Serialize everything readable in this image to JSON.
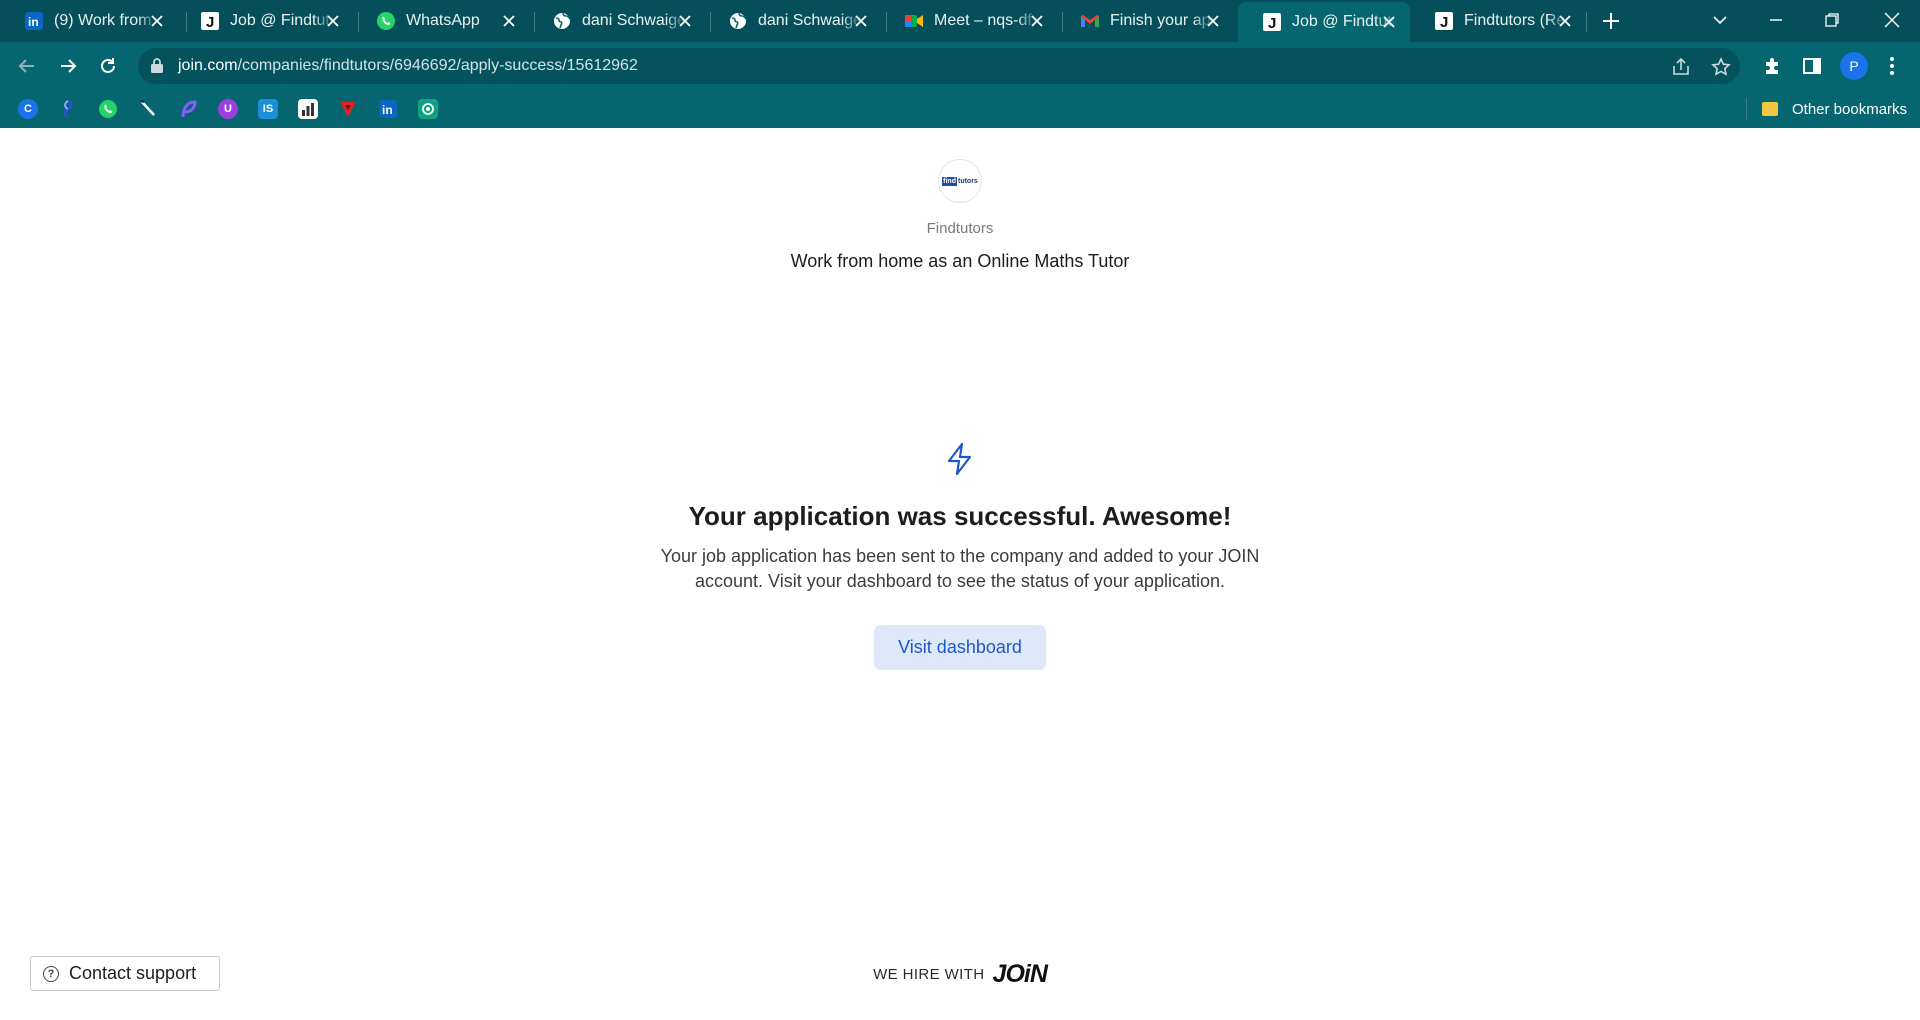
{
  "browser": {
    "tabs": [
      {
        "title": "(9) Work from",
        "icon": "linkedin-icon",
        "active": false
      },
      {
        "title": "Job @ Findtutors",
        "icon": "join-icon",
        "active": false
      },
      {
        "title": "WhatsApp",
        "icon": "whatsapp-icon",
        "active": false
      },
      {
        "title": "dani Schwaiger",
        "icon": "globe-icon",
        "active": false
      },
      {
        "title": "dani Schwaiger",
        "icon": "globe-icon",
        "active": false
      },
      {
        "title": "Meet – nqs-dfx",
        "icon": "google-meet-icon",
        "active": false
      },
      {
        "title": "Finish your application",
        "icon": "gmail-icon",
        "active": false
      },
      {
        "title": "Job @ Findtutors",
        "icon": "join-icon",
        "active": true
      },
      {
        "title": "Findtutors (Re",
        "icon": "join-icon",
        "active": false
      }
    ],
    "url_host": "join.com",
    "url_path": "/companies/findtutors/6946692/apply-success/15612962",
    "profile_initial": "P",
    "bookmarks": [
      {
        "icon": "c-bookmark-icon",
        "label": "C",
        "color": "#1a73e8"
      },
      {
        "icon": "swirl-bookmark-icon",
        "label": "",
        "color": "#2a4fd0"
      },
      {
        "icon": "whatsapp-bookmark-icon",
        "label": "",
        "color": "#25d366"
      },
      {
        "icon": "pen-bookmark-icon",
        "label": "",
        "color": "#06666f"
      },
      {
        "icon": "feather-bookmark-icon",
        "label": "",
        "color": "#6a3cff"
      },
      {
        "icon": "u-bookmark-icon",
        "label": "U",
        "color": "#9b3fe0"
      },
      {
        "icon": "is-bookmark-icon",
        "label": "IS",
        "color": "#1b8fd8"
      },
      {
        "icon": "chart-bookmark-icon",
        "label": "",
        "color": "#ffffff"
      },
      {
        "icon": "v-bookmark-icon",
        "label": "",
        "color": "#d9252a"
      },
      {
        "icon": "linkedin-bookmark-icon",
        "label": "in",
        "color": "#0a66c2"
      },
      {
        "icon": "openai-bookmark-icon",
        "label": "",
        "color": "#10a37f"
      }
    ],
    "other_bookmarks": "Other bookmarks"
  },
  "page": {
    "company_name": "Findtutors",
    "logo_text_a": "find",
    "logo_text_b": "tutors",
    "job_title": "Work from home as an Online Maths Tutor",
    "headline": "Your application was successful. Awesome!",
    "description": "Your job application has been sent to the company and added to your JOIN account. Visit your dashboard to see the status of your application.",
    "dashboard_button": "Visit dashboard",
    "support_button": "Contact support",
    "hire_with": "WE HIRE WITH",
    "join_brand": "JOiN",
    "accent_color": "#1f57c7"
  }
}
